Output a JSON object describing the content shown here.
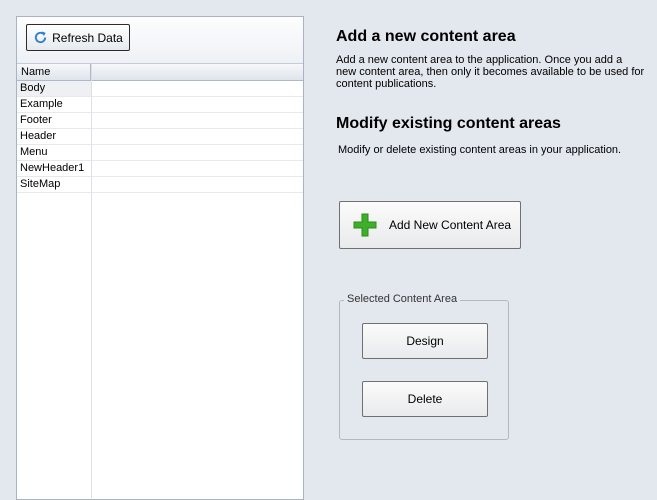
{
  "toolbar": {
    "refresh_label": "Refresh Data",
    "refresh_icon": "refresh-icon"
  },
  "grid": {
    "columns": [
      "Name"
    ],
    "rows": [
      "Body",
      "Example",
      "Footer",
      "Header",
      "Menu",
      "NewHeader1",
      "SiteMap"
    ],
    "selected_row": "Body"
  },
  "add_section": {
    "heading": "Add a new content area",
    "description_lines": [
      "Add a new content area to the application. Once you add a",
      "new content area, then only it becomes available to be used for",
      "content publications."
    ]
  },
  "modify_section": {
    "heading": "Modify existing content areas",
    "description": "Modify or delete existing content areas in your application."
  },
  "add_button": {
    "label": "Add New Content Area",
    "icon": "plus-icon",
    "icon_color": "#3fae2a"
  },
  "selected_group": {
    "legend": "Selected Content Area",
    "design_label": "Design",
    "delete_label": "Delete"
  }
}
